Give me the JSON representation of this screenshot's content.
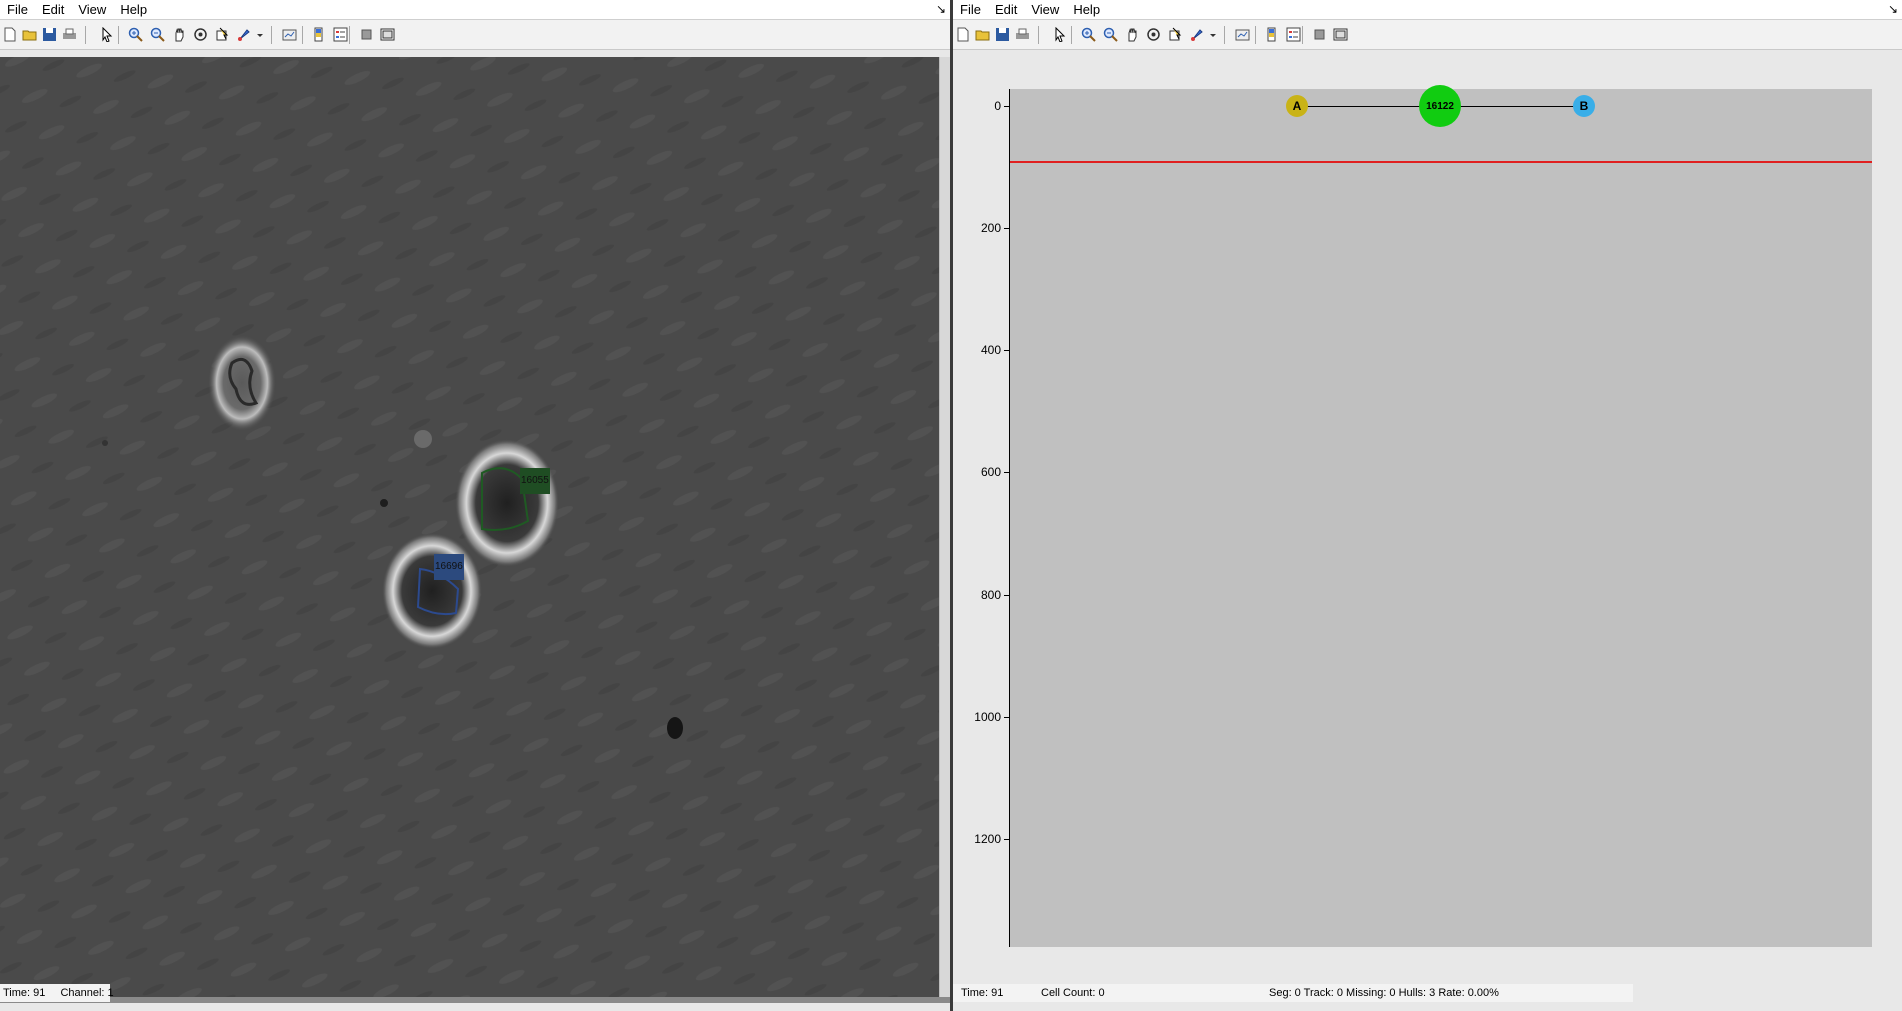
{
  "left_window": {
    "menu": [
      "File",
      "Edit",
      "View",
      "Help"
    ],
    "dock_glyph": "↘",
    "toolbar_icons": [
      "new-file-icon",
      "open-folder-icon",
      "save-icon",
      "print-icon",
      "pointer-icon",
      "zoom-in-icon",
      "zoom-out-icon",
      "pan-hand-icon",
      "rotate-3d-icon",
      "data-cursor-icon",
      "brush-icon",
      "brush-dropdown-icon",
      "link-plot-icon",
      "colorbar-icon",
      "legend-icon",
      "hide-tools-icon",
      "show-tools-icon"
    ],
    "cells": [
      {
        "id": "16055",
        "label": "16055",
        "color": "#1f4d23"
      },
      {
        "id": "16696",
        "label": "16696",
        "color": "#2c4a7e"
      }
    ],
    "status": {
      "time": "Time: 91",
      "channel": "Channel: 1"
    }
  },
  "right_window": {
    "menu": [
      "File",
      "Edit",
      "View",
      "Help"
    ],
    "dock_glyph": "↘",
    "toolbar_icons": [
      "new-file-icon",
      "open-folder-icon",
      "save-icon",
      "print-icon",
      "pointer-icon",
      "zoom-in-icon",
      "zoom-out-icon",
      "pan-hand-icon",
      "rotate-3d-icon",
      "data-cursor-icon",
      "brush-icon",
      "brush-dropdown-icon",
      "link-plot-icon",
      "colorbar-icon",
      "legend-icon",
      "hide-tools-icon",
      "show-tools-icon"
    ],
    "lineage": {
      "y_axis": {
        "ticks": [
          0,
          200,
          400,
          600,
          800,
          1000,
          1200
        ],
        "range": [
          -27,
          1376
        ],
        "reversed": true
      },
      "current_time": 91,
      "nodes": [
        {
          "id": "A",
          "label": "A",
          "color": "#c9b316",
          "time": 0
        },
        {
          "id": "16122",
          "label": "16122",
          "color": "#11cc11",
          "time": 0
        },
        {
          "id": "B",
          "label": "B",
          "color": "#39aee8",
          "time": 0
        }
      ],
      "colors": {
        "plot_bg": "#c0c0c0",
        "time_line": "#e02020"
      }
    },
    "status": {
      "time": "Time: 91",
      "cell_count": "Cell Count: 0",
      "summary": "Seg: 0 Track: 0 Missing: 0 Hulls: 3 Rate: 0.00%"
    }
  }
}
